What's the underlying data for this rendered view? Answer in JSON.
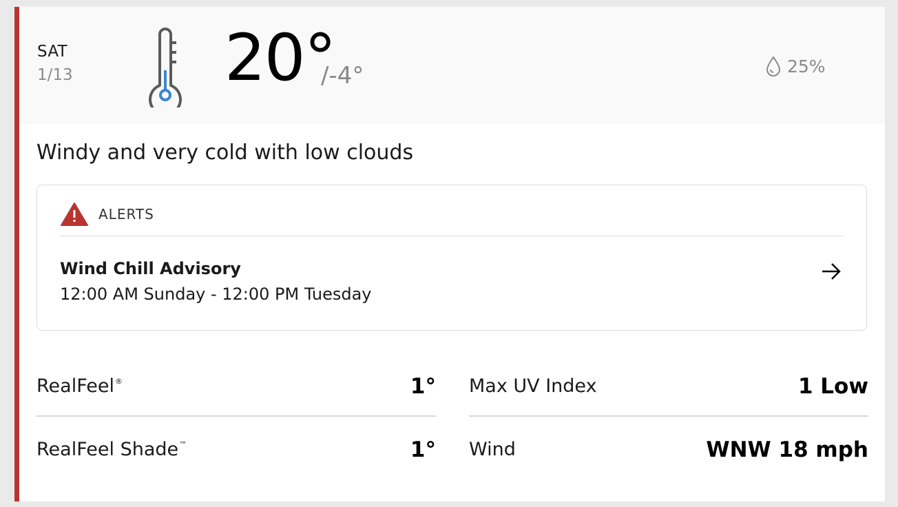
{
  "forecast": {
    "day": "SAT",
    "date": "1/13",
    "high": "20°",
    "low": "/-4°",
    "precip_icon": "raindrop-icon",
    "precip": "25%",
    "phrase": "Windy and very cold with low clouds"
  },
  "alerts": {
    "icon": "warning-triangle-icon",
    "header": "ALERTS",
    "item": {
      "title": "Wind Chill Advisory",
      "time": "12:00 AM Sunday - 12:00 PM Tuesday",
      "arrow_icon": "arrow-right-icon"
    }
  },
  "stats": {
    "realfeel": {
      "label": "RealFeel",
      "mark": "®",
      "value": "1°"
    },
    "realfeel_shade": {
      "label": "RealFeel Shade",
      "mark": "™",
      "value": "1°"
    },
    "max_uv": {
      "label": "Max UV Index",
      "value": "1 Low"
    },
    "wind": {
      "label": "Wind",
      "value": "WNW 18 mph"
    }
  },
  "colors": {
    "accent": "#b8352f",
    "alert_icon": "#b8352f",
    "thermometer_outline": "#5a5a5a",
    "thermometer_bulb": "#3a86d1"
  }
}
